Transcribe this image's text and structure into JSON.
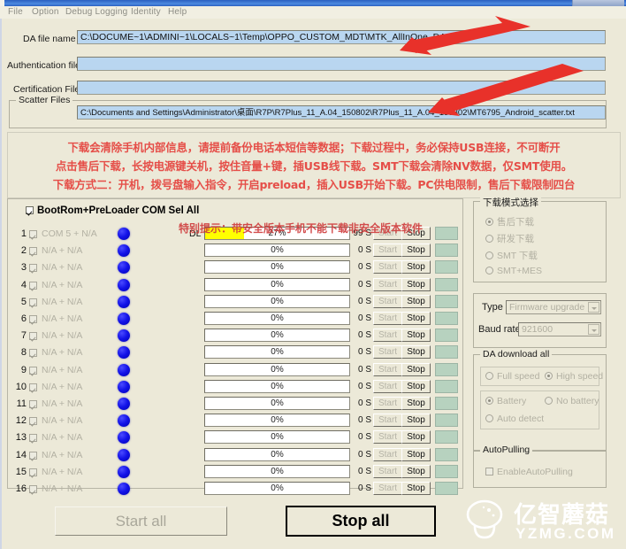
{
  "window": {
    "menu": [
      "File",
      "Option",
      "Debug Logging",
      "Identity",
      "Help"
    ]
  },
  "files": {
    "da_label": "DA file name",
    "da_value": "C:\\DOCUME~1\\ADMINI~1\\LOCALS~1\\Temp\\OPPO_CUSTOM_MDT\\MTK_AllInOne_DA.bin",
    "auth_label": "Authentication file",
    "auth_value": "",
    "cert_label": "Certification File",
    "cert_value": "",
    "scatter_group": "Scatter Files",
    "scatter_value": "C:\\Documents and Settings\\Administrator\\桌面\\R7P\\R7Plus_11_A.04_150802\\R7Plus_11_A.04_150802\\MT6795_Android_scatter.txt"
  },
  "warning": {
    "line1": "下载会清除手机内部信息，请提前备份电话本短信等数据；下载过程中，务必保持USB连接，不可断开",
    "line2": "点击售后下载，长按电源键关机，按住音量+键，插USB线下载。SMT下载会清除NV数据，仅SMT使用。",
    "line3": "下载方式二：开机，拨号盘输入指令，开启preload，插入USB开始下载。PC供电限制，售后下载限制四台"
  },
  "ports": {
    "select_all_label": "BootRom+PreLoader COM Sel All",
    "select_all_checked": true,
    "notice": "特别提示：带安全版本手机不能下载非安全版本软件",
    "dl_label": "DL",
    "start_label": "Start",
    "stop_label": "Stop",
    "rows": [
      {
        "num": "1",
        "name": "COM 5 + N/A",
        "percent": "27%",
        "fill": 27,
        "seconds": "99 S"
      },
      {
        "num": "2",
        "name": "N/A + N/A",
        "percent": "0%",
        "fill": 0,
        "seconds": "0 S"
      },
      {
        "num": "3",
        "name": "N/A + N/A",
        "percent": "0%",
        "fill": 0,
        "seconds": "0 S"
      },
      {
        "num": "4",
        "name": "N/A + N/A",
        "percent": "0%",
        "fill": 0,
        "seconds": "0 S"
      },
      {
        "num": "5",
        "name": "N/A + N/A",
        "percent": "0%",
        "fill": 0,
        "seconds": "0 S"
      },
      {
        "num": "6",
        "name": "N/A + N/A",
        "percent": "0%",
        "fill": 0,
        "seconds": "0 S"
      },
      {
        "num": "7",
        "name": "N/A + N/A",
        "percent": "0%",
        "fill": 0,
        "seconds": "0 S"
      },
      {
        "num": "8",
        "name": "N/A + N/A",
        "percent": "0%",
        "fill": 0,
        "seconds": "0 S"
      },
      {
        "num": "9",
        "name": "N/A + N/A",
        "percent": "0%",
        "fill": 0,
        "seconds": "0 S"
      },
      {
        "num": "10",
        "name": "N/A + N/A",
        "percent": "0%",
        "fill": 0,
        "seconds": "0 S"
      },
      {
        "num": "11",
        "name": "N/A + N/A",
        "percent": "0%",
        "fill": 0,
        "seconds": "0 S"
      },
      {
        "num": "12",
        "name": "N/A + N/A",
        "percent": "0%",
        "fill": 0,
        "seconds": "0 S"
      },
      {
        "num": "13",
        "name": "N/A + N/A",
        "percent": "0%",
        "fill": 0,
        "seconds": "0 S"
      },
      {
        "num": "14",
        "name": "N/A + N/A",
        "percent": "0%",
        "fill": 0,
        "seconds": "0 S"
      },
      {
        "num": "15",
        "name": "N/A + N/A",
        "percent": "0%",
        "fill": 0,
        "seconds": "0 S"
      },
      {
        "num": "16",
        "name": "N/A + N/A",
        "percent": "0%",
        "fill": 0,
        "seconds": "0 S"
      }
    ]
  },
  "sidebar": {
    "mode_group": "下载模式选择",
    "mode_options": [
      {
        "label": "售后下载",
        "selected": true
      },
      {
        "label": "研发下载",
        "selected": false
      },
      {
        "label": "SMT 下载",
        "selected": false
      },
      {
        "label": "SMT+MES",
        "selected": false
      }
    ],
    "type_label": "Type",
    "type_value": "Firmware upgrade",
    "baud_label": "Baud rate",
    "baud_value": "921600",
    "da_group": "DA download all",
    "speed_options": [
      {
        "label": "Full speed",
        "selected": false
      },
      {
        "label": "High speed",
        "selected": true
      }
    ],
    "battery_options": [
      {
        "label": "Battery",
        "selected": true
      },
      {
        "label": "No battery",
        "selected": false
      },
      {
        "label": "Auto detect",
        "selected": false
      }
    ],
    "autopolling_group": "AutoPulling",
    "autopolling_label": "EnableAutoPulling",
    "autopolling_checked": false
  },
  "footer": {
    "start_all": "Start all",
    "stop_all": "Stop all"
  },
  "watermark": {
    "cn": "亿智蘑菇",
    "en": "YZMG.COM"
  },
  "colors": {
    "accent_blue": "#b9d6f0",
    "progress_yellow": "#ffff00",
    "warning_red": "#e53935",
    "dot_blue": "#1313e8",
    "window_bg": "#ece9d8"
  }
}
